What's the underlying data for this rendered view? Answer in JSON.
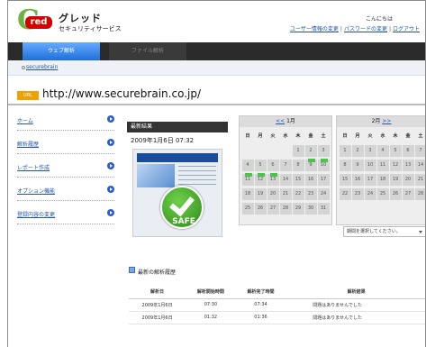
{
  "header": {
    "logo_mark": "G",
    "logo_word": "red",
    "title": "グレッド",
    "subtitle": "セキュリティサービス",
    "greeting": "こんにちは",
    "links": [
      "ユーザー情報の変更",
      "パスワードの変更",
      "ログアウト"
    ]
  },
  "tabs": [
    {
      "label": "ウェブ解析"
    },
    {
      "label": "ファイル解析"
    }
  ],
  "subbar": {
    "link": "securebrain"
  },
  "url_row": {
    "badge": "URL",
    "url": "http://www.securebrain.co.jp/"
  },
  "sidebar": {
    "items": [
      {
        "label": "ホーム"
      },
      {
        "label": "解析履歴"
      },
      {
        "label": "レポート作成"
      },
      {
        "label": "オプション機能"
      },
      {
        "label": "登録内容の変更"
      }
    ]
  },
  "result": {
    "heading": "最新結果",
    "date": "2009年1月6日 07:32",
    "verdict": "SAFE"
  },
  "calendar1": {
    "prev_link": "<<",
    "month": "1月",
    "dows": [
      "日",
      "月",
      "火",
      "水",
      "木",
      "金",
      "土"
    ],
    "weeks": [
      [
        "",
        "",
        "",
        "",
        "1",
        "2",
        "3"
      ],
      [
        "4",
        "5",
        "6",
        "7",
        "8",
        "9",
        "10"
      ],
      [
        "11",
        "12",
        "13",
        "14",
        "15",
        "16",
        "17"
      ],
      [
        "18",
        "19",
        "20",
        "21",
        "22",
        "23",
        "24"
      ],
      [
        "25",
        "26",
        "27",
        "28",
        "29",
        "30",
        "31"
      ]
    ],
    "marked_days": [
      "2",
      "3",
      "4",
      "5",
      "6"
    ]
  },
  "calendar2": {
    "month": "2月",
    "next_link": ">>",
    "dows": [
      "日",
      "月",
      "火",
      "水",
      "木",
      "金",
      "土"
    ],
    "weeks": [
      [
        "1",
        "2",
        "3",
        "4",
        "5",
        "6",
        "7"
      ],
      [
        "8",
        "9",
        "10",
        "11",
        "12",
        "13",
        "14"
      ],
      [
        "15",
        "16",
        "17",
        "18",
        "19",
        "20",
        "21"
      ],
      [
        "22",
        "23",
        "24",
        "25",
        "26",
        "27",
        "28"
      ]
    ]
  },
  "period_select": {
    "value": "期間を選択してください。"
  },
  "history": {
    "title": "最新の解析履歴",
    "columns": [
      "解析日",
      "解析開始時間",
      "解析完了時間",
      "解析結果"
    ],
    "rows": [
      [
        "2009年1月6日",
        "07:30",
        "07:34",
        "問題はありませんでした"
      ],
      [
        "2009年1月6日",
        "01:32",
        "01:36",
        "問題はありませんでした"
      ]
    ]
  },
  "colors": {
    "tab_active": "#1e6fd8",
    "accent_link": "#2255aa",
    "safe_green": "#3aa52a",
    "marker_green": "#4cc34a",
    "url_badge": "#f0a000"
  }
}
